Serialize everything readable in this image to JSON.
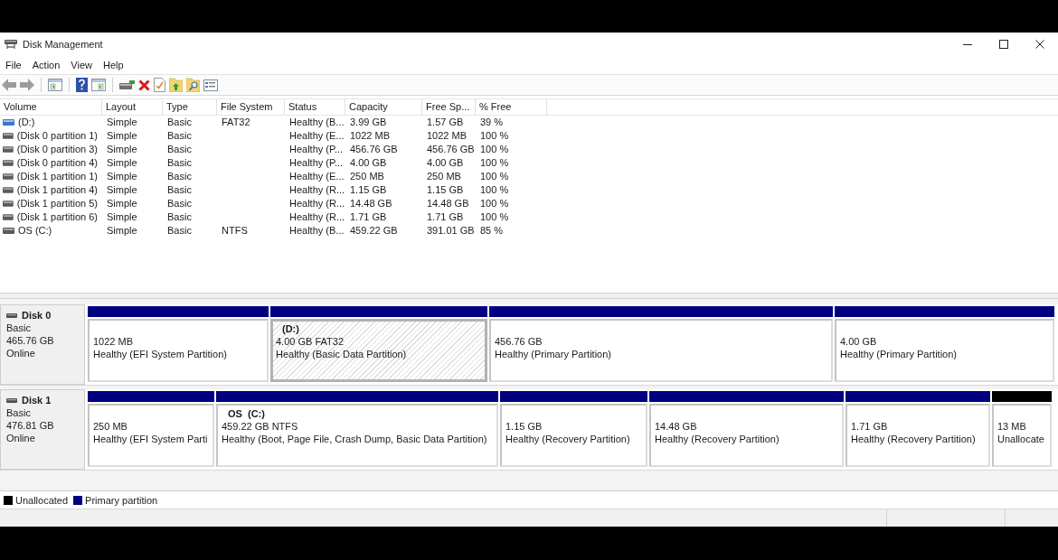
{
  "window": {
    "title": "Disk Management"
  },
  "menu": [
    "File",
    "Action",
    "View",
    "Help"
  ],
  "volumes": {
    "columns": [
      "Volume",
      "Layout",
      "Type",
      "File System",
      "Status",
      "Capacity",
      "Free Sp...",
      "% Free"
    ],
    "rows": [
      {
        "volume": "(D:)",
        "layout": "Simple",
        "type": "Basic",
        "file_system": "FAT32",
        "status": "Healthy (B...",
        "capacity": "3.99 GB",
        "free_space": "1.57 GB",
        "percent_free": "39 %",
        "selected": true
      },
      {
        "volume": "(Disk 0 partition 1)",
        "layout": "Simple",
        "type": "Basic",
        "status": "Healthy (E...",
        "capacity": "1022 MB",
        "free_space": "1022 MB",
        "percent_free": "100 %",
        "selected": false
      },
      {
        "volume": "(Disk 0 partition 3)",
        "layout": "Simple",
        "type": "Basic",
        "status": "Healthy (P...",
        "capacity": "456.76 GB",
        "free_space": "456.76 GB",
        "percent_free": "100 %",
        "selected": false
      },
      {
        "volume": "(Disk 0 partition 4)",
        "layout": "Simple",
        "type": "Basic",
        "status": "Healthy (P...",
        "capacity": "4.00 GB",
        "free_space": "4.00 GB",
        "percent_free": "100 %",
        "selected": false
      },
      {
        "volume": "(Disk 1 partition 1)",
        "layout": "Simple",
        "type": "Basic",
        "status": "Healthy (E...",
        "capacity": "250 MB",
        "free_space": "250 MB",
        "percent_free": "100 %",
        "selected": false
      },
      {
        "volume": "(Disk 1 partition 4)",
        "layout": "Simple",
        "type": "Basic",
        "status": "Healthy (R...",
        "capacity": "1.15 GB",
        "free_space": "1.15 GB",
        "percent_free": "100 %",
        "selected": false
      },
      {
        "volume": "(Disk 1 partition 5)",
        "layout": "Simple",
        "type": "Basic",
        "status": "Healthy (R...",
        "capacity": "14.48 GB",
        "free_space": "14.48 GB",
        "percent_free": "100 %",
        "selected": false
      },
      {
        "volume": "(Disk 1 partition 6)",
        "layout": "Simple",
        "type": "Basic",
        "status": "Healthy (R...",
        "capacity": "1.71 GB",
        "free_space": "1.71 GB",
        "percent_free": "100 %",
        "selected": false
      },
      {
        "volume": "OS (C:)",
        "layout": "Simple",
        "type": "Basic",
        "file_system": "NTFS",
        "status": "Healthy (B...",
        "capacity": "459.22 GB",
        "free_space": "391.01 GB",
        "percent_free": "85 %",
        "selected": false
      }
    ]
  },
  "disks": [
    {
      "name": "Disk 0",
      "type": "Basic",
      "size": "465.76 GB",
      "status": "Online",
      "partitions": [
        {
          "size": "1022 MB",
          "status": "Healthy (EFI System Partition)",
          "color": "#000080",
          "selected": false
        },
        {
          "name": "(D:)",
          "size": "4.00 GB FAT32",
          "status": "Healthy (Basic Data Partition)",
          "color": "#000080",
          "selected": true
        },
        {
          "size": "456.76 GB",
          "status": "Healthy (Primary Partition)",
          "color": "#000080",
          "selected": false
        },
        {
          "size": "4.00 GB",
          "status": "Healthy (Primary Partition)",
          "color": "#000080",
          "selected": false
        }
      ]
    },
    {
      "name": "Disk 1",
      "type": "Basic",
      "size": "476.81 GB",
      "status": "Online",
      "partitions": [
        {
          "size": "250 MB",
          "status": "Healthy (EFI System Parti",
          "color": "#000080",
          "selected": false
        },
        {
          "name": "OS  (C:)",
          "size": "459.22 GB NTFS",
          "status": "Healthy (Boot, Page File, Crash Dump, Basic Data Partition)",
          "color": "#000080",
          "selected": false
        },
        {
          "size": "1.15 GB",
          "status": "Healthy (Recovery Partition)",
          "color": "#000080",
          "selected": false
        },
        {
          "size": "14.48 GB",
          "status": "Healthy (Recovery Partition)",
          "color": "#000080",
          "selected": false
        },
        {
          "size": "1.71 GB",
          "status": "Healthy (Recovery Partition)",
          "color": "#000080",
          "selected": false
        },
        {
          "size": "13 MB",
          "status": "Unallocate",
          "color": "#000000",
          "selected": false
        }
      ]
    }
  ],
  "legend": [
    {
      "label": "Unallocated",
      "color": "#000000"
    },
    {
      "label": "Primary partition",
      "color": "#000080"
    }
  ]
}
